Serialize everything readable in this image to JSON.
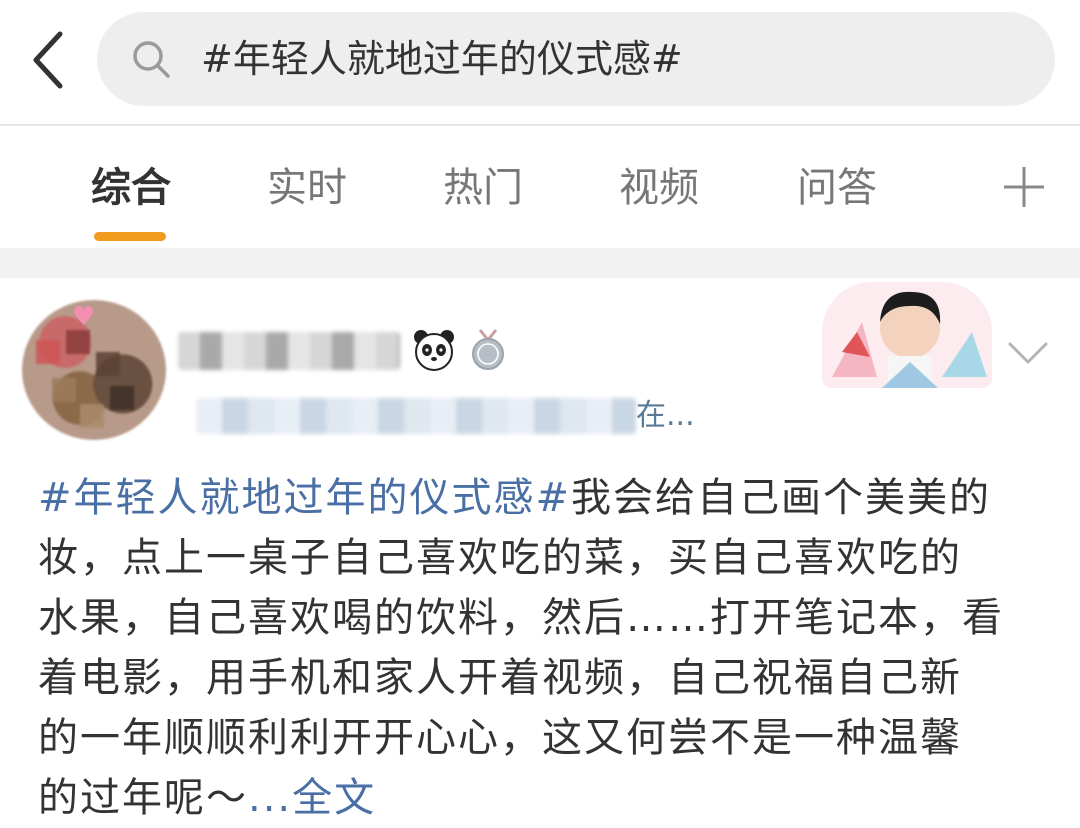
{
  "header": {
    "search_query": "#年轻人就地过年的仪式感#"
  },
  "tabs": [
    {
      "label": "综合",
      "active": true
    },
    {
      "label": "实时",
      "active": false
    },
    {
      "label": "热门",
      "active": false
    },
    {
      "label": "视频",
      "active": false
    },
    {
      "label": "问答",
      "active": false
    }
  ],
  "post": {
    "meta_tail": "在...",
    "body_lines": [
      {
        "tag": "#年轻人就地过年的仪式感#",
        "text": "我会给自己画个美美的"
      },
      {
        "text": "妆，点上一桌子自己喜欢吃的菜，买自己喜欢吃的"
      },
      {
        "text": "水果，自己喜欢喝的饮料，然后……打开笔记本，看"
      },
      {
        "text": "着电影，用手机和家人开着视频，自己祝福自己新"
      },
      {
        "text": "的一年顺顺利利开开心心，这又何尝不是一种温馨"
      },
      {
        "text": "的过年呢～",
        "more": "...全文"
      }
    ]
  },
  "colors": {
    "accent": "#f29c1f",
    "link": "#4a6fa5",
    "text": "#333333",
    "muted": "#777777"
  },
  "icons": [
    "back-icon",
    "search-icon",
    "add-icon",
    "panda-icon",
    "medal-icon",
    "chevron-down-icon"
  ]
}
